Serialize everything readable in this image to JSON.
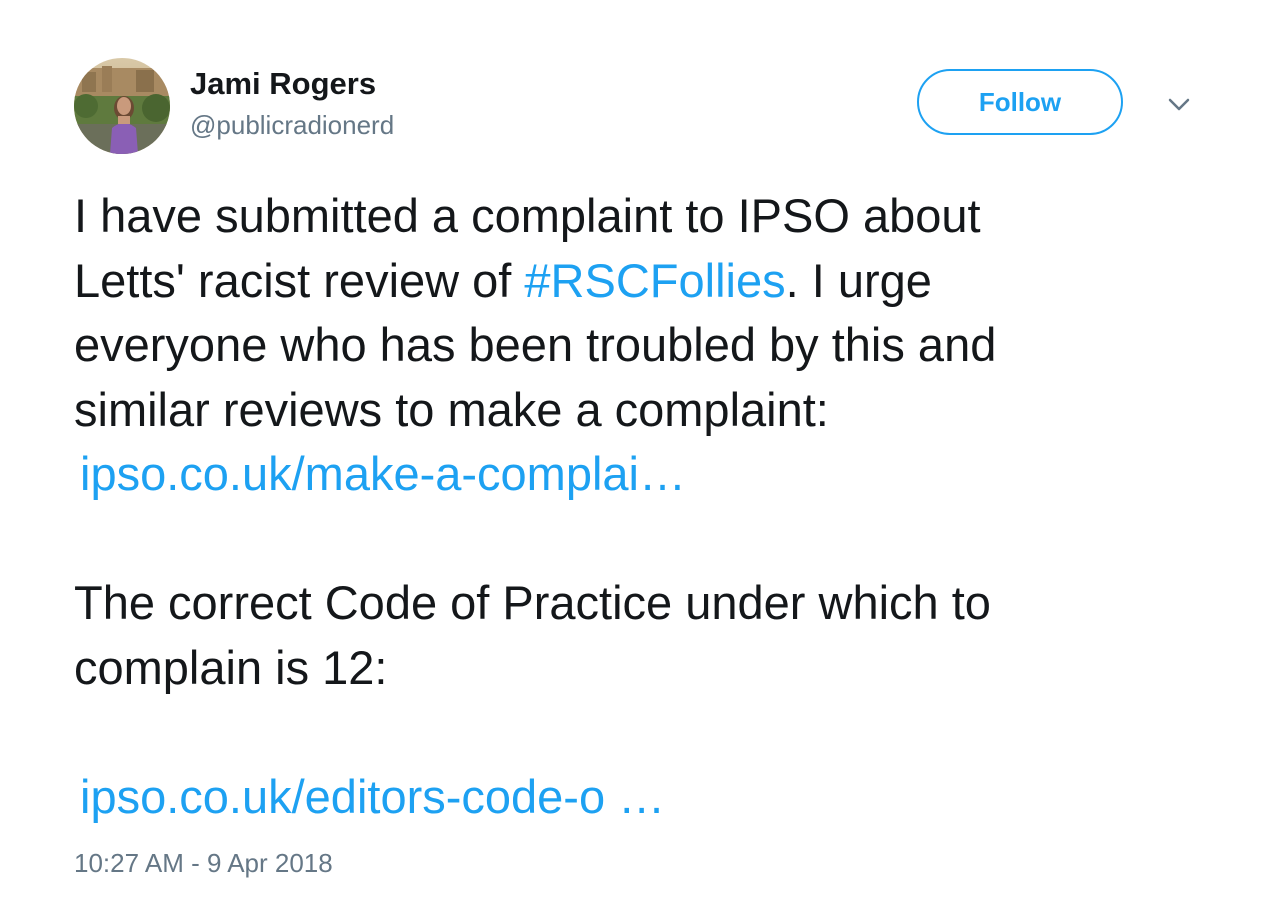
{
  "author": {
    "name": "Jami Rogers",
    "handle": "@publicradionerd"
  },
  "actions": {
    "follow_label": "Follow",
    "more_icon": "chevron-down-icon"
  },
  "tweet": {
    "line1": "I have submitted a complaint to IPSO about",
    "line2_pre": "Letts' racist review of ",
    "hashtag": "#RSCFollies",
    "line2_post": ". I urge",
    "line3": "everyone who has been troubled by this and",
    "line4": "similar reviews to make a complaint:",
    "link1": "ipso.co.uk/make-a-complai…",
    "line6": "The correct Code of Practice under which to",
    "line7": "complain is 12:",
    "link2": "ipso.co.uk/editors-code-o …"
  },
  "timestamp": "10:27 AM - 9 Apr 2018",
  "colors": {
    "link": "#1da1f2",
    "text": "#14171a",
    "secondary": "#657786"
  }
}
